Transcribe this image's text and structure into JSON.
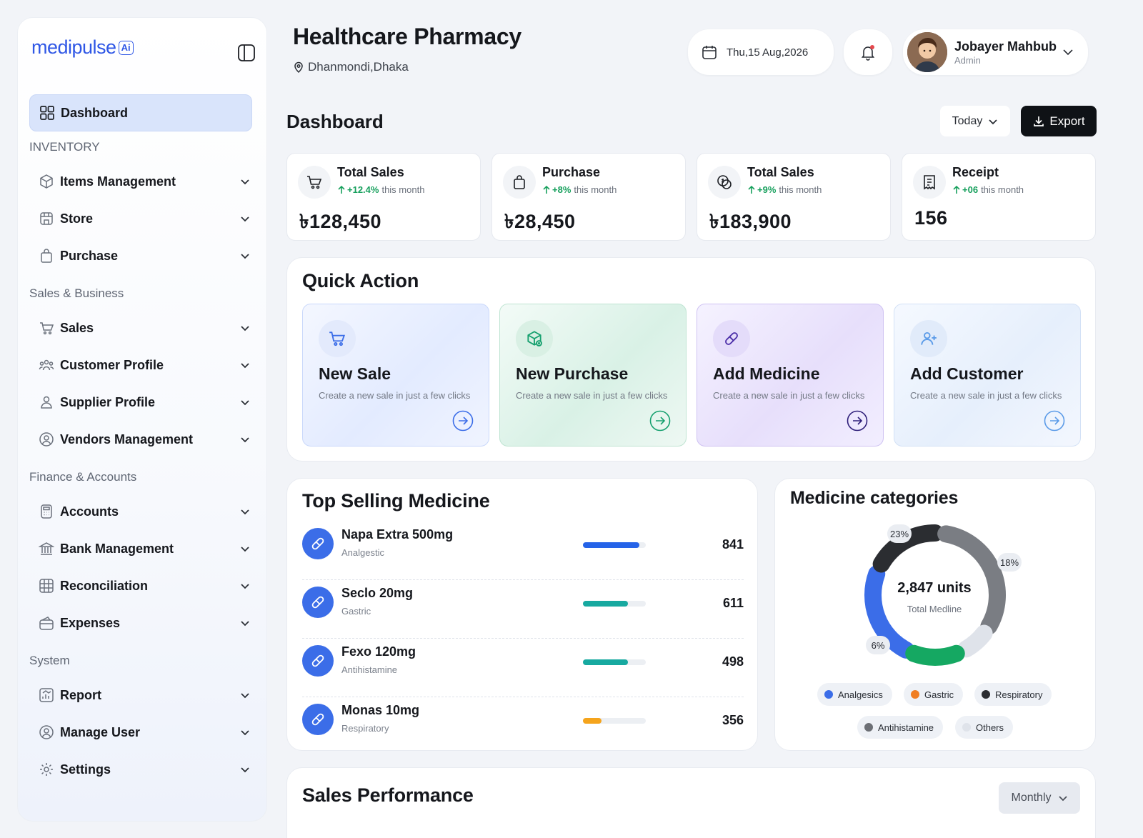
{
  "brand": {
    "logo_main": "medipulse",
    "logo_badge": "Ai"
  },
  "sidebar": {
    "active": {
      "label": "Dashboard",
      "icon": "grid-icon"
    },
    "sections": [
      {
        "title": "INVENTORY"
      },
      {
        "title": "Sales & Business"
      },
      {
        "title": "Finance & Accounts"
      },
      {
        "title": "System"
      }
    ],
    "items": [
      {
        "label": "Items Management",
        "icon": "box-icon"
      },
      {
        "label": "Store",
        "icon": "store-icon"
      },
      {
        "label": "Purchase",
        "icon": "bag-icon"
      },
      {
        "label": "Sales",
        "icon": "cart-icon"
      },
      {
        "label": "Customer Profile",
        "icon": "users-icon"
      },
      {
        "label": "Supplier Profile",
        "icon": "user-icon"
      },
      {
        "label": "Vendors Management",
        "icon": "vendor-icon"
      },
      {
        "label": "Accounts",
        "icon": "calculator-icon"
      },
      {
        "label": "Bank Management",
        "icon": "bank-icon"
      },
      {
        "label": "Reconciliation",
        "icon": "grid-table-icon"
      },
      {
        "label": "Expenses",
        "icon": "wallet-icon"
      },
      {
        "label": "Report",
        "icon": "report-icon"
      },
      {
        "label": "Manage User",
        "icon": "user-circle-icon"
      },
      {
        "label": "Settings",
        "icon": "gear-icon"
      }
    ]
  },
  "header": {
    "store_name": "Healthcare Pharmacy",
    "location": "Dhanmondi,Dhaka",
    "date": "Thu,15 Aug,2026",
    "user": {
      "name": "Jobayer Mahbub",
      "role": "Admin"
    }
  },
  "dashboard": {
    "title": "Dashboard",
    "range_label": "Today",
    "export_label": "Export"
  },
  "stats": [
    {
      "title": "Total Sales",
      "change": "+12.4%",
      "period": "this month",
      "value": "৳128,450",
      "icon": "cart-icon"
    },
    {
      "title": "Purchase",
      "change": "+8%",
      "period": "this month",
      "value": "৳28,450",
      "icon": "bag-icon"
    },
    {
      "title": "Total Sales",
      "change": "+9%",
      "period": "this month",
      "value": "৳183,900",
      "icon": "coins-icon"
    },
    {
      "title": "Receipt",
      "change": "+06",
      "period": "this month",
      "value": "156",
      "icon": "receipt-icon"
    }
  ],
  "quick_action": {
    "title": "Quick Action",
    "cards": [
      {
        "title": "New Sale",
        "desc": "Create a new sale in just a few clicks",
        "accent": "#3b6de8"
      },
      {
        "title": "New Purchase",
        "desc": "Create a new sale in just a few clicks",
        "accent": "#15a06e"
      },
      {
        "title": "Add Medicine",
        "desc": "Create a new sale in just a few clicks",
        "accent": "#4b2ea8"
      },
      {
        "title": "Add Customer",
        "desc": "Create a new sale in just a few clicks",
        "accent": "#5b9be8"
      }
    ]
  },
  "top_selling": {
    "title": "Top Selling Medicine",
    "rows": [
      {
        "name": "Napa Extra 500mg",
        "category": "Analgestic",
        "count": "841",
        "fill": 0.9,
        "color": "#2563e8"
      },
      {
        "name": "Seclo 20mg",
        "category": "Gastric",
        "count": "611",
        "fill": 0.72,
        "color": "#17a9a0"
      },
      {
        "name": "Fexo 120mg",
        "category": "Antihistamine",
        "count": "498",
        "fill": 0.72,
        "color": "#17a9a0"
      },
      {
        "name": "Monas 10mg",
        "category": "Respiratory",
        "count": "356",
        "fill": 0.3,
        "color": "#f5a41c"
      }
    ]
  },
  "categories": {
    "title": "Medicine categories",
    "total_value": "2,847 units",
    "total_label": "Total Medline",
    "badges": [
      "23%",
      "18%",
      "6%"
    ],
    "legend": [
      {
        "label": "Analgesics",
        "color": "#3b6de8"
      },
      {
        "label": "Gastric",
        "color": "#f07e22"
      },
      {
        "label": "Respiratory",
        "color": "#2b2d31"
      },
      {
        "label": "Antihistamine",
        "color": "#6c6f75"
      },
      {
        "label": "Others",
        "color": "#dfe3ea"
      }
    ]
  },
  "sales_performance": {
    "title": "Sales Performance",
    "range_label": "Monthly"
  }
}
